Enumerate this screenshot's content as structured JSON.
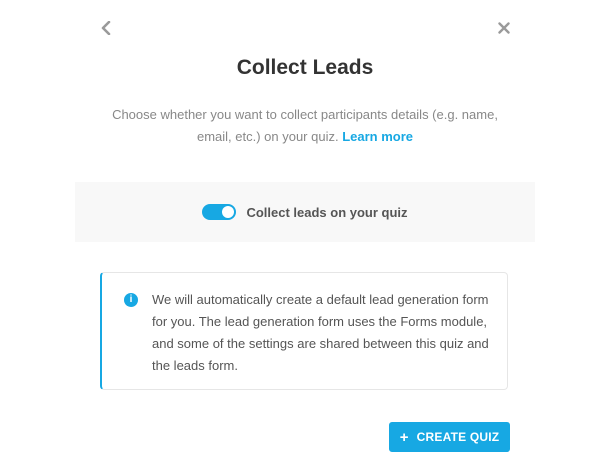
{
  "modal": {
    "title": "Collect Leads",
    "description": "Choose whether you want to collect participants details (e.g. name, email, etc.) on your quiz.",
    "learn_more": "Learn more",
    "back_icon": "chevron-left-icon",
    "close_icon": "close-icon"
  },
  "toggle": {
    "label": "Collect leads on your quiz",
    "state": "on"
  },
  "notice": {
    "icon": "info-icon",
    "icon_glyph": "i",
    "text": "We will automatically create a default lead generation form for you. The lead generation form uses the Forms module, and some of the settings are shared between this quiz and the leads form."
  },
  "footer": {
    "create_icon": "+",
    "create_label": "CREATE QUIZ"
  },
  "colors": {
    "accent": "#17a8e3",
    "title": "#333333",
    "muted": "#888888",
    "band": "#f8f8f8"
  }
}
